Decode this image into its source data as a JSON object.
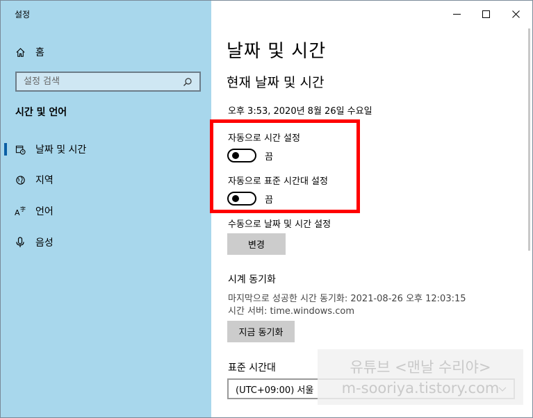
{
  "window": {
    "title": "설정"
  },
  "sidebar": {
    "home_label": "홈",
    "search_placeholder": "설정 검색",
    "section_title": "시간 및 언어",
    "items": [
      {
        "label": "날짜 및 시간",
        "icon": "calendar-clock-icon",
        "selected": true
      },
      {
        "label": "지역",
        "icon": "globe-icon",
        "selected": false
      },
      {
        "label": "언어",
        "icon": "language-icon",
        "selected": false
      },
      {
        "label": "음성",
        "icon": "microphone-icon",
        "selected": false
      }
    ]
  },
  "main": {
    "page_title": "날짜 및 시간",
    "sub_title": "현재 날짜 및 시간",
    "current_datetime": "오후 3:53, 2020년 8월 26일 수요일",
    "auto_time_label": "자동으로 시간 설정",
    "auto_time_state": "끔",
    "auto_time_on": false,
    "auto_tz_label": "자동으로 표준 시간대 설정",
    "auto_tz_state": "끔",
    "auto_tz_on": false,
    "manual_label": "수동으로 날짜 및 시간 설정",
    "change_button": "변경",
    "sync_title": "시계 동기화",
    "last_sync": "마지막으로 성공한 시간 동기화: 2021-08-26 오후 12:03:15",
    "time_server": "시간 서버: time.windows.com",
    "sync_button": "지금 동기화",
    "tz_label": "표준 시간대",
    "tz_value": "(UTC+09:00) 서울"
  },
  "watermark": {
    "line1": "유튜브 <맨날 수리야>",
    "line2": "m-sooriya.tistory.com"
  },
  "colors": {
    "sidebar_bg": "#a8d7ec",
    "highlight": "#ff0000",
    "button_bg": "#cccccc",
    "accent": "#0b5fa5"
  }
}
